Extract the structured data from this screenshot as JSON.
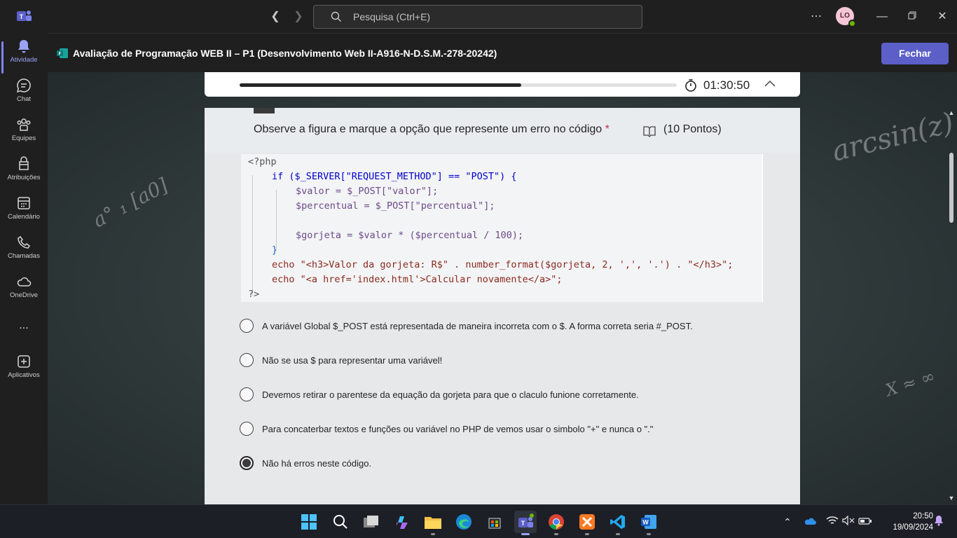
{
  "titlebar": {
    "search_placeholder": "Pesquisa (Ctrl+E)",
    "avatar_initials": "LO",
    "icons": [
      "teams-logo-icon",
      "back-arrow-icon",
      "forward-arrow-icon",
      "search-icon",
      "more-options-icon",
      "minimize-icon",
      "restore-icon",
      "close-window-icon"
    ]
  },
  "rail": {
    "items": [
      {
        "label": "Atividade",
        "icon": "bell-icon"
      },
      {
        "label": "Chat",
        "icon": "chat-icon"
      },
      {
        "label": "Equipes",
        "icon": "teams-icon"
      },
      {
        "label": "Atribuições",
        "icon": "assignments-icon"
      },
      {
        "label": "Calendário",
        "icon": "calendar-icon"
      },
      {
        "label": "Chamadas",
        "icon": "phone-icon"
      },
      {
        "label": "OneDrive",
        "icon": "cloud-icon"
      },
      {
        "label": "Aplicativos",
        "icon": "add-apps-icon"
      }
    ],
    "more": "..."
  },
  "dialog": {
    "title": "Avaliação de Programação WEB II – P1 (Desenvolvimento Web II-A916-N-D.S.M.-278-20242)",
    "close_label": "Fechar"
  },
  "timer": {
    "progress_percent": 64.5,
    "time": "01:30:50"
  },
  "question": {
    "text": "Observe a figura e marque a opção que represente um erro no código",
    "required_mark": "*",
    "points": "(10 Pontos)",
    "code_lines": [
      "<?php",
      "if ($_SERVER[\"REQUEST_METHOD\"] == \"POST\") {",
      "$valor = $_POST[\"valor\"];",
      "$percentual = $_POST[\"percentual\"];",
      "",
      "$gorjeta = $valor * ($percentual / 100);",
      "}",
      "echo \"<h3>Valor da gorjeta: R$\" . number_format($gorjeta, 2, ',', '.') . \"</h3>\";",
      "echo \"<a href='index.html'>Calcular novamente</a>\";",
      "?>"
    ],
    "options": [
      {
        "label": "A variável Global $_POST está representada de maneira incorreta com o $. A forma correta seria #_POST.",
        "checked": false
      },
      {
        "label": "Não se usa $ para representar uma variável!",
        "checked": false
      },
      {
        "label": "Devemos retirar o parentese da equação da gorjeta para que o claculo funione corretamente.",
        "checked": false
      },
      {
        "label": "Para concaterbar textos e funções ou variável no PHP de vemos usar o simbolo \"+\" e nunca o \".\"",
        "checked": false
      },
      {
        "label": "Não há erros neste código.",
        "checked": true
      }
    ]
  },
  "background_chalk": [
    "arcsin(z)",
    "a° ₁ [a0]",
    "X ≈ ∞"
  ],
  "taskbar": {
    "apps": [
      "windows-start-icon",
      "search-icon",
      "task-view-icon",
      "copilot-icon",
      "file-explorer-icon",
      "edge-icon",
      "store-icon",
      "teams-icon",
      "chrome-icon",
      "xampp-icon",
      "vscode-icon",
      "word-icon"
    ],
    "time": "20:50",
    "date": "19/09/2024"
  },
  "colors": {
    "accent": "#5b5fc7",
    "panel": "#e6e8e9",
    "presence": "#6bb700"
  }
}
